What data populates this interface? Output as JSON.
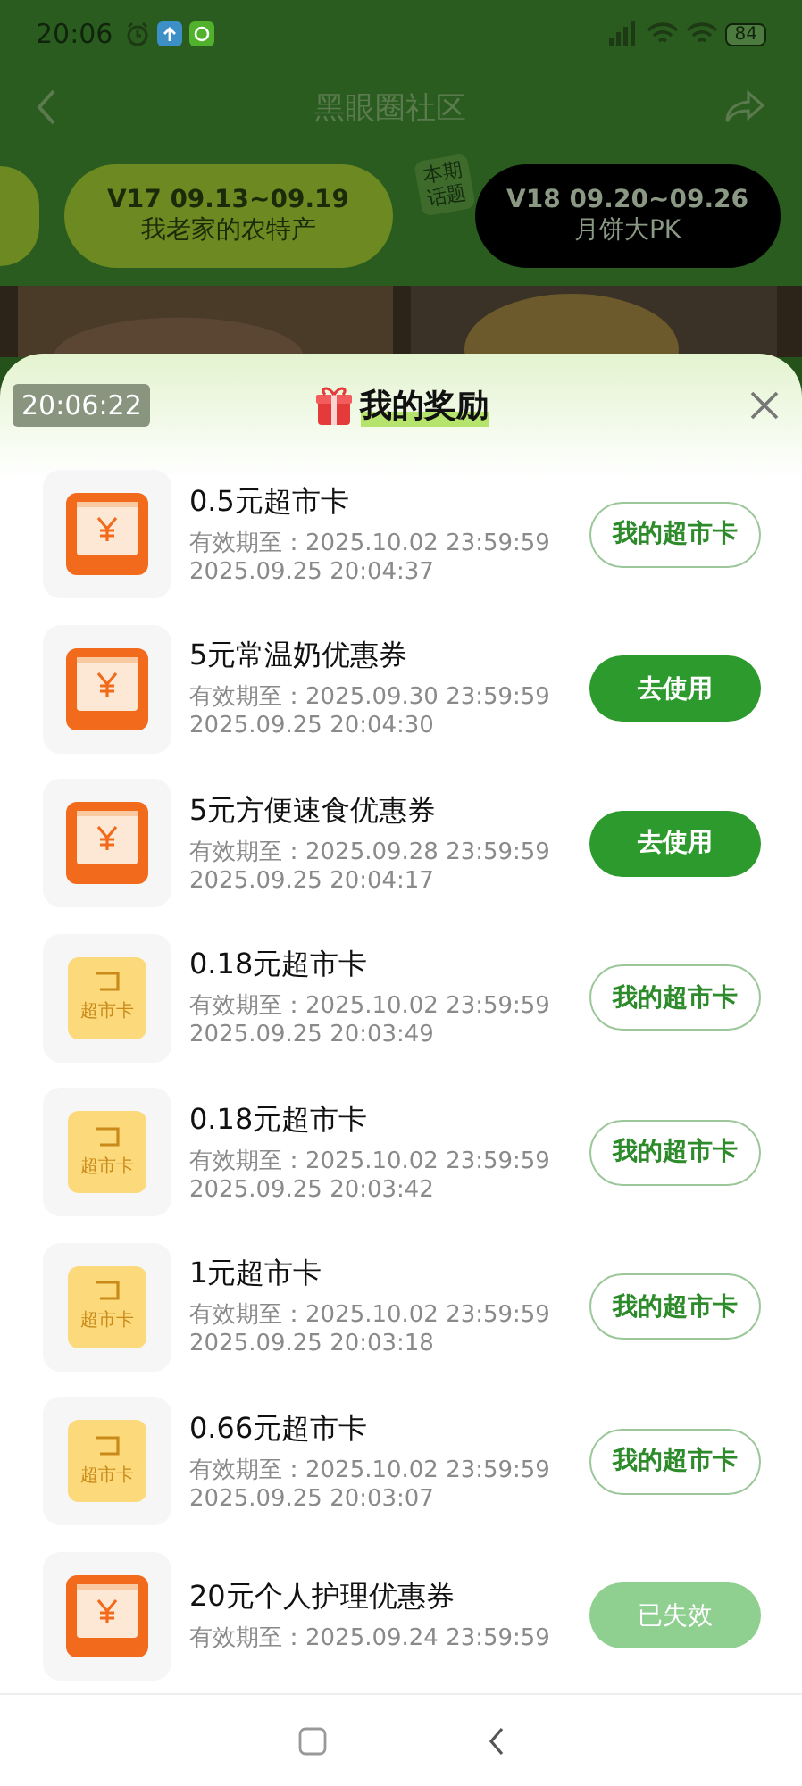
{
  "status_bar": {
    "time": "20:06",
    "battery": "84"
  },
  "nav": {
    "title": "黑眼圈社区"
  },
  "topics": [
    {
      "code": "V17 09.13~09.19",
      "name": "我老家的农特产",
      "selected": false
    },
    {
      "code": "V18 09.20~09.26",
      "name": "月饼大PK",
      "selected": true,
      "badge": "本期话题"
    }
  ],
  "sheet": {
    "timestamp": "20:06:22",
    "title": "我的奖励"
  },
  "rewards": [
    {
      "kind": "coupon",
      "title": "0.5元超市卡",
      "expiry": "有效期至：2025.10.02 23:59:59",
      "received": "2025.09.25 20:04:37",
      "button": {
        "kind": "outline",
        "label": "我的超市卡"
      }
    },
    {
      "kind": "coupon",
      "title": "5元常温奶优惠券",
      "expiry": "有效期至：2025.09.30 23:59:59",
      "received": "2025.09.25 20:04:30",
      "button": {
        "kind": "filled",
        "label": "去使用"
      }
    },
    {
      "kind": "coupon",
      "title": "5元方便速食优惠券",
      "expiry": "有效期至：2025.09.28 23:59:59",
      "received": "2025.09.25 20:04:17",
      "button": {
        "kind": "filled",
        "label": "去使用"
      }
    },
    {
      "kind": "card",
      "icon_label": "超市卡",
      "title": "0.18元超市卡",
      "expiry": "有效期至：2025.10.02 23:59:59",
      "received": "2025.09.25 20:03:49",
      "button": {
        "kind": "outline",
        "label": "我的超市卡"
      }
    },
    {
      "kind": "card",
      "icon_label": "超市卡",
      "title": "0.18元超市卡",
      "expiry": "有效期至：2025.10.02 23:59:59",
      "received": "2025.09.25 20:03:42",
      "button": {
        "kind": "outline",
        "label": "我的超市卡"
      }
    },
    {
      "kind": "card",
      "icon_label": "超市卡",
      "title": "1元超市卡",
      "expiry": "有效期至：2025.10.02 23:59:59",
      "received": "2025.09.25 20:03:18",
      "button": {
        "kind": "outline",
        "label": "我的超市卡"
      }
    },
    {
      "kind": "card",
      "icon_label": "超市卡",
      "title": "0.66元超市卡",
      "expiry": "有效期至：2025.10.02 23:59:59",
      "received": "2025.09.25 20:03:07",
      "button": {
        "kind": "outline",
        "label": "我的超市卡"
      }
    },
    {
      "kind": "coupon",
      "title": "20元个人护理优惠券",
      "expiry": "有效期至：2025.09.24 23:59:59",
      "button": {
        "kind": "expired",
        "label": "已失效"
      }
    }
  ]
}
